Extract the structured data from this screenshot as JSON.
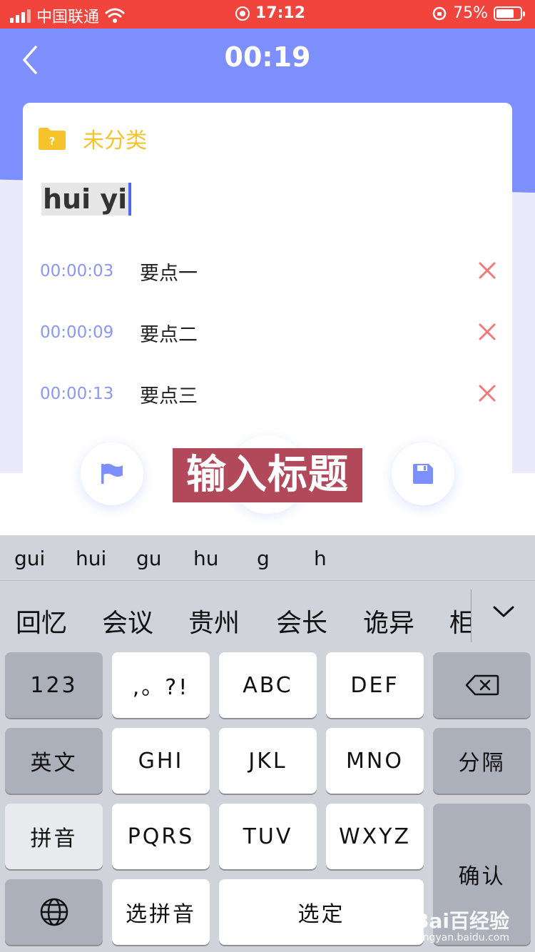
{
  "status_bar": {
    "carrier": "中国联通",
    "time": "17:12",
    "battery": "75%",
    "battery_level": 0.75
  },
  "header": {
    "timer": "00:19"
  },
  "card": {
    "category": "未分类",
    "title_value": "hui yi",
    "points": [
      {
        "time": "00:00:03",
        "label": "要点一"
      },
      {
        "time": "00:00:09",
        "label": "要点二"
      },
      {
        "time": "00:00:13",
        "label": "要点三"
      }
    ]
  },
  "caption": "输入标题",
  "keyboard": {
    "pinyin_options": [
      "gui",
      "hui",
      "gu",
      "hu",
      "g",
      "h"
    ],
    "candidates": [
      "回忆",
      "会议",
      "贵州",
      "会长",
      "诡异",
      "柜"
    ],
    "keys": {
      "numbers": "123",
      "punct": ",。?!",
      "abc": "ABC",
      "def": "DEF",
      "english": "英文",
      "ghi": "GHI",
      "jkl": "JKL",
      "mno": "MNO",
      "separator": "分隔",
      "pinyin": "拼音",
      "pqrs": "PQRS",
      "tuv": "TUV",
      "wxyz": "WXYZ",
      "confirm": "确认",
      "select_pinyin": "选拼音",
      "select": "选定"
    }
  },
  "watermark": {
    "brand": "Bai百经验",
    "url": "jingyan.baidu.com"
  },
  "colors": {
    "status_bar": "#f0443c",
    "header": "#7d8ffc",
    "category": "#f6c32a",
    "time": "#8a98f5",
    "delete": "#f07a7a",
    "caption_bg": "#b2495a"
  }
}
